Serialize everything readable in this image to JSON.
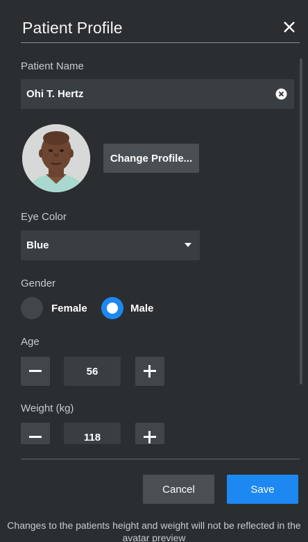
{
  "dialog": {
    "title": "Patient Profile"
  },
  "patient_name": {
    "label": "Patient Name",
    "value": "Ohi T. Hertz"
  },
  "profile": {
    "change_button": "Change Profile..."
  },
  "eye_color": {
    "label": "Eye Color",
    "selected": "Blue"
  },
  "gender": {
    "label": "Gender",
    "options": [
      "Female",
      "Male"
    ],
    "selected": "Male"
  },
  "age": {
    "label": "Age",
    "value": "56"
  },
  "weight": {
    "label": "Weight (kg)",
    "value": "118"
  },
  "footer": {
    "cancel_label": "Cancel",
    "save_label": "Save",
    "note": "Changes to the patients height and weight will not be reflected in the avatar preview"
  },
  "colors": {
    "background": "#2a2e31",
    "field": "#393e42",
    "accent": "#1d88f2"
  },
  "icons": [
    "close-icon",
    "clear-input-icon",
    "caret-down-icon",
    "minus-icon",
    "plus-icon"
  ]
}
